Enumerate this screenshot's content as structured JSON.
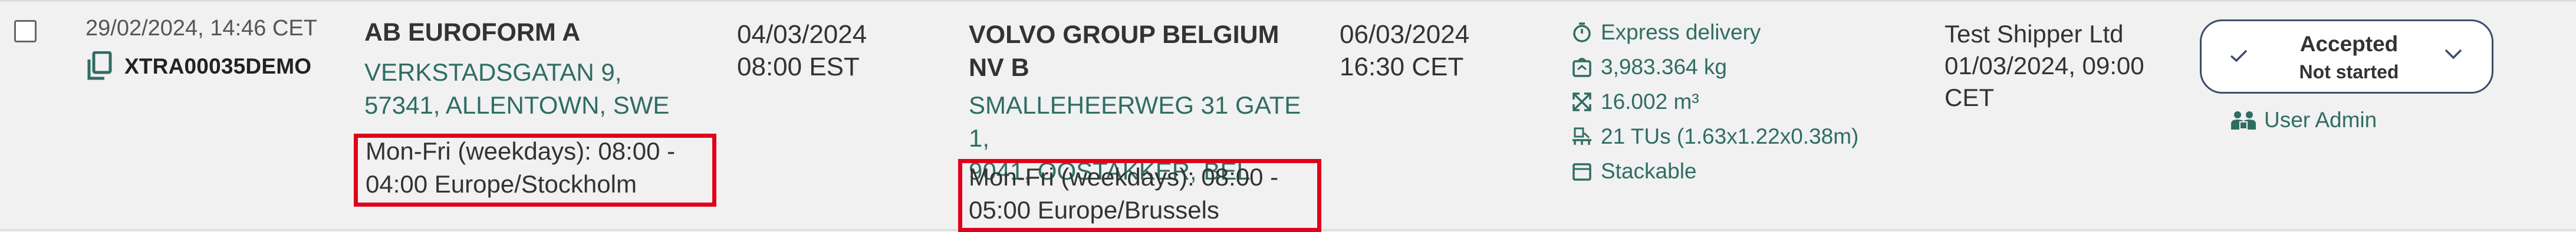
{
  "row": {
    "created": "29/02/2024, 14:46 CET",
    "reference_id": "XTRA00035DEMO",
    "pickup": {
      "name": "AB EUROFORM A",
      "address_line1": "VERKSTADSGATAN 9,",
      "address_line2": "57341, ALLENTOWN, SWE",
      "hours_line1": "Mon-Fri (weekdays): 08:00 -",
      "hours_line2": "04:00 Europe/Stockholm",
      "date": "04/03/2024",
      "time": "08:00 EST"
    },
    "delivery": {
      "name": "VOLVO GROUP BELGIUM NV B",
      "address_line1": "SMALLEHEERWEG 31 GATE 1,",
      "address_line2": "9041, OOSTAKKER, BEL",
      "hours_line1": "Mon-Fri (weekdays): 08:00 -",
      "hours_line2": "05:00 Europe/Brussels",
      "date": "06/03/2024",
      "time": "16:30 CET"
    },
    "info": {
      "service": "Express delivery",
      "weight": "3,983.364 kg",
      "volume": "16.002 m³",
      "units": "21 TUs (1.63x1.22x0.38m)",
      "stackable": "Stackable"
    },
    "shipper": {
      "name": "Test Shipper Ltd",
      "date_line1": "01/03/2024, 09:00",
      "date_line2": "CET"
    },
    "status": {
      "label": "Accepted",
      "sublabel": "Not started"
    },
    "user": "User Admin"
  },
  "colors": {
    "accent": "#2f6d63",
    "highlight_border": "#e0001b",
    "background": "#f1f1f1"
  },
  "icons": [
    "copy-icon",
    "stopwatch-icon",
    "weight-icon",
    "volume-icon",
    "pallet-icon",
    "box-icon",
    "check-icon",
    "chevron-down-icon",
    "users-icon"
  ]
}
